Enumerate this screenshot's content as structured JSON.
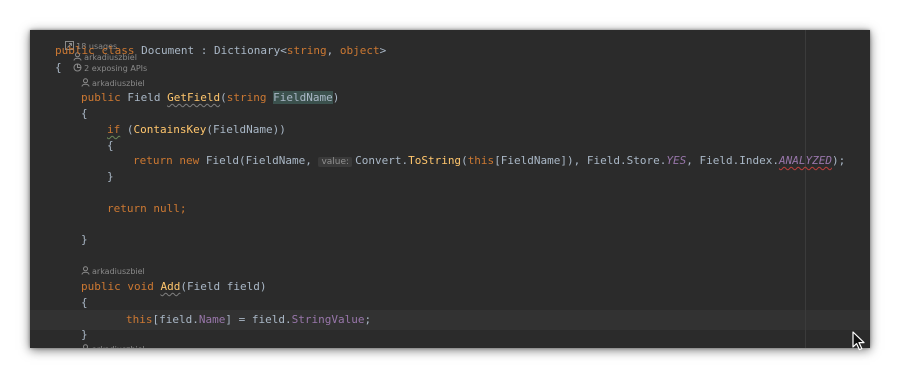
{
  "class_lens": {
    "usages": "18 usages",
    "author": "arkadiuszbiel",
    "apis": "2 exposing APIs"
  },
  "code": {
    "class_decl": {
      "public": "public",
      "class": "class",
      "name": "Document",
      "colon": " : ",
      "base": "Dictionary<",
      "t1": "string",
      "comma": ", ",
      "t2": "object",
      "close": ">"
    },
    "open_brace": "{",
    "getfield_author": "arkadiuszbiel",
    "getfield_sig": {
      "public": "public",
      "type": "Field",
      "name": "GetField",
      "lparen": "(",
      "ptype": "string",
      "pname": "FieldName",
      "rparen": ")"
    },
    "getfield_open": "{",
    "if_line": {
      "if": "if",
      "lparen": " (",
      "method": "ContainsKey",
      "args": "(FieldName)",
      "rparen": ")"
    },
    "if_open": "{",
    "return_line": {
      "return": "return",
      "new": "new",
      "ctor": "Field(FieldName, ",
      "hint": "value:",
      "convert": "Convert.",
      "tostring": "ToString",
      "lparen": "(",
      "this": "this",
      "idx": "[FieldName]), Field.Store.",
      "yes": "YES",
      "mid": ", Field.Index.",
      "analyzed": "ANALYZED",
      "end": ");"
    },
    "if_close": "}",
    "return_null": {
      "return": "return",
      "null": "null",
      "semi": ";"
    },
    "getfield_close": "}",
    "add_author": "arkadiuszbiel",
    "add_sig": {
      "public": "public",
      "void": "void",
      "name": "Add",
      "params": "(Field field)"
    },
    "add_open": "{",
    "assign_line": {
      "this": "this",
      "lb": "[field.",
      "name": "Name",
      "mid": "] = field.",
      "value": "StringValue",
      "semi": ";"
    },
    "add_close": "}",
    "next_author": "arkadiuszbiel"
  }
}
